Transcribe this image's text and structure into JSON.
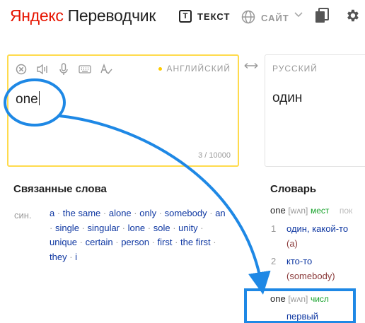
{
  "header": {
    "logo_brand": "Яндекс",
    "logo_product": "Переводчик",
    "tab_text_label": "ТЕКСТ",
    "tab_text_icon_letter": "T",
    "tab_site_label": "САЙТ"
  },
  "source": {
    "language": "АНГЛИЙСКИЙ",
    "text": "one",
    "counter": "3 / 10000"
  },
  "target": {
    "language": "РУССКИЙ",
    "text": "один"
  },
  "related": {
    "title": "Связанные слова",
    "syn_label": "син.",
    "words": [
      "a",
      "the same",
      "alone",
      "only",
      "somebody",
      "an",
      "single",
      "singular",
      "lone",
      "sole",
      "unity",
      "unique",
      "certain",
      "person",
      "first",
      "the first",
      "they",
      "i"
    ]
  },
  "dictionary": {
    "title": "Словарь",
    "entries": [
      {
        "word": "one",
        "transcription": "[wʌn]",
        "pos": "мест",
        "extra": "пок",
        "meanings": [
          {
            "num": "1",
            "text": "один, какой-то",
            "example": "(a)"
          },
          {
            "num": "2",
            "text": "кто-то",
            "example": "(somebody)"
          }
        ]
      },
      {
        "word": "one",
        "transcription": "[wʌn]",
        "pos": "числ",
        "meanings": [
          {
            "text": "первый"
          }
        ]
      }
    ]
  },
  "colors": {
    "brand_red": "#e61400",
    "source_border": "#ffdb4d",
    "link_blue": "#0d36a1",
    "pos_green": "#17a22b",
    "annotation_blue": "#1e88e5"
  },
  "icons": [
    "t-icon",
    "globe-icon",
    "chevron-down-icon",
    "cards-icon",
    "gear-icon",
    "clear-icon",
    "speaker-icon",
    "microphone-icon",
    "keyboard-icon",
    "spellcheck-icon",
    "swap-icon"
  ]
}
